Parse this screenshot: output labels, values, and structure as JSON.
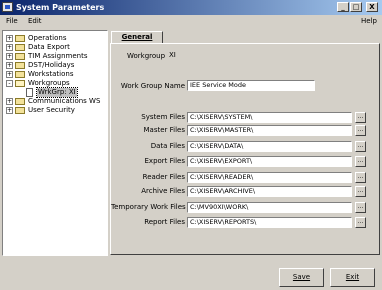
{
  "window": {
    "title": "System Parameters",
    "controls": [
      "_",
      "□",
      "X"
    ]
  },
  "menu": {
    "file": "File",
    "edit": "Edit",
    "help": "Help"
  },
  "tree": {
    "items": [
      {
        "label": "Operations",
        "expander": "+",
        "icon": "folder-icon"
      },
      {
        "label": "Data Export",
        "expander": "+",
        "icon": "folder-icon"
      },
      {
        "label": "TIM Assignments",
        "expander": "+",
        "icon": "folder-icon"
      },
      {
        "label": "DST/Holidays",
        "expander": "+",
        "icon": "folder-icon"
      },
      {
        "label": "Workstations",
        "expander": "+",
        "icon": "folder-icon"
      },
      {
        "label": "Workgroups",
        "expander": "-",
        "icon": "folder-open-icon"
      },
      {
        "label": "WrkGrp: XI",
        "expander": "",
        "icon": "document-icon",
        "selected": true
      },
      {
        "label": "Communications WS",
        "expander": "+",
        "icon": "folder-icon"
      },
      {
        "label": "User Security",
        "expander": "+",
        "icon": "folder-icon"
      }
    ]
  },
  "tabs": {
    "general": "General"
  },
  "general": {
    "workgroup_label": "Workgroup",
    "workgroup_value": "XI",
    "workgroup_name_label": "Work Group Name",
    "workgroup_name_value": "IEE Service Mode",
    "browse_label": "...",
    "files": [
      {
        "label": "System Files",
        "value": "C:\\XISERV\\SYSTEM\\"
      },
      {
        "label": "Master Files",
        "value": "C:\\XISERV\\MASTER\\"
      },
      {
        "label": "Data Files",
        "value": "C:\\XISERV\\DATA\\"
      },
      {
        "label": "Export Files",
        "value": "C:\\XISERV\\EXPORT\\"
      },
      {
        "label": "Reader Files",
        "value": "C:\\XISERV\\READER\\"
      },
      {
        "label": "Archive Files",
        "value": "C:\\XISERV\\ARCHIVE\\"
      },
      {
        "label": "Temporary Work Files",
        "value": "C:\\MV90XI\\WORK\\"
      },
      {
        "label": "Report Files",
        "value": "C:\\XISERV\\REPORTS\\"
      }
    ]
  },
  "buttons": {
    "save": "Save",
    "exit": "Exit"
  }
}
